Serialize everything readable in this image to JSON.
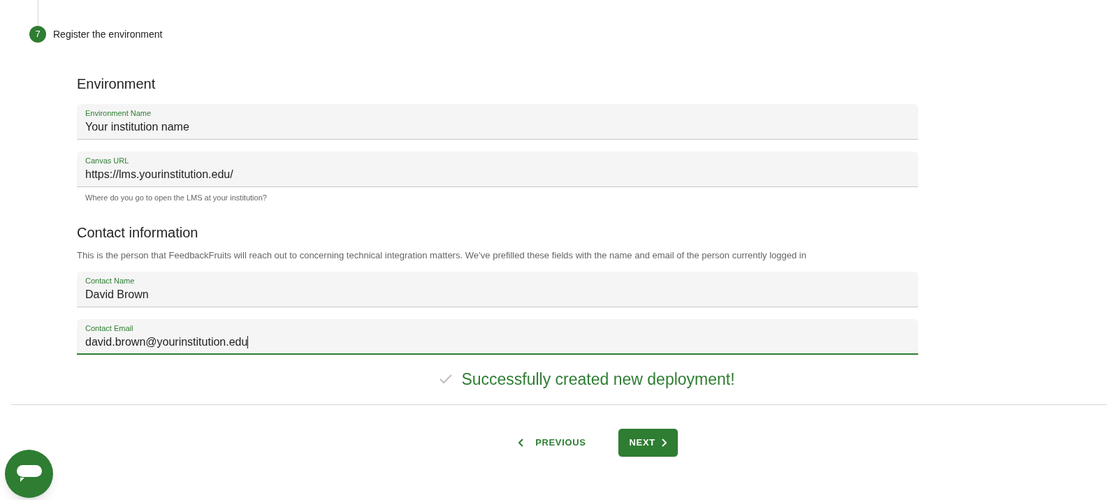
{
  "step": {
    "number": "7",
    "title": "Register the environment"
  },
  "sections": [
    {
      "heading": "Environment",
      "fields": [
        {
          "label": "Environment Name",
          "value": "Your institution name",
          "focused": false
        },
        {
          "label": "Canvas URL",
          "value": "https://lms.yourinstitution.edu/",
          "focused": false,
          "hint": "Where do you go to open the LMS at your institution?"
        }
      ]
    },
    {
      "heading": "Contact information",
      "description": "This is the person that FeedbackFruits will reach out to concerning technical integration matters. We’ve prefilled these fields with the name and email of the person currently logged in",
      "fields": [
        {
          "label": "Contact Name",
          "value": "David Brown",
          "focused": false
        },
        {
          "label": "Contact Email",
          "value": "david.brown@yourinstitution.edu",
          "focused": true
        }
      ]
    }
  ],
  "success_message": "Successfully created new deployment!",
  "buttons": [
    {
      "kind": "previous",
      "label": "PREVIOUS"
    },
    {
      "kind": "next",
      "label": "NEXT"
    }
  ]
}
